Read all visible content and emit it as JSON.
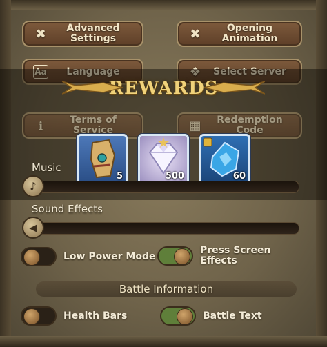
{
  "buttons": {
    "advanced_settings": "Advanced\nSettings",
    "opening_animation": "Opening\nAnimation",
    "language": "Language",
    "select_server": "Select Server",
    "terms_of_service": "Terms of Service",
    "redemption_code": "Redemption Code"
  },
  "rewards_popup": {
    "title": "REWARDS",
    "items": [
      {
        "icon": "gauntlet-icon",
        "count": "5"
      },
      {
        "icon": "diamond-icon",
        "count": "500"
      },
      {
        "icon": "crystal-shard-icon",
        "count": "60"
      }
    ]
  },
  "sliders": {
    "music_label": "Music",
    "sound_effects_label": "Sound Effects"
  },
  "toggles": {
    "low_power_mode": {
      "label": "Low Power Mode",
      "state": "off"
    },
    "press_screen_effects": {
      "label": "Press Screen\nEffects",
      "state": "on"
    },
    "health_bars": {
      "label": "Health Bars",
      "state": "off"
    },
    "battle_text": {
      "label": "Battle Text",
      "state": "on"
    }
  },
  "section": {
    "battle_information": "Battle Information"
  },
  "colors": {
    "toggle_on": "#5f7f3a",
    "toggle_off": "#2a2117",
    "banner_gold": "#f0d27a"
  }
}
